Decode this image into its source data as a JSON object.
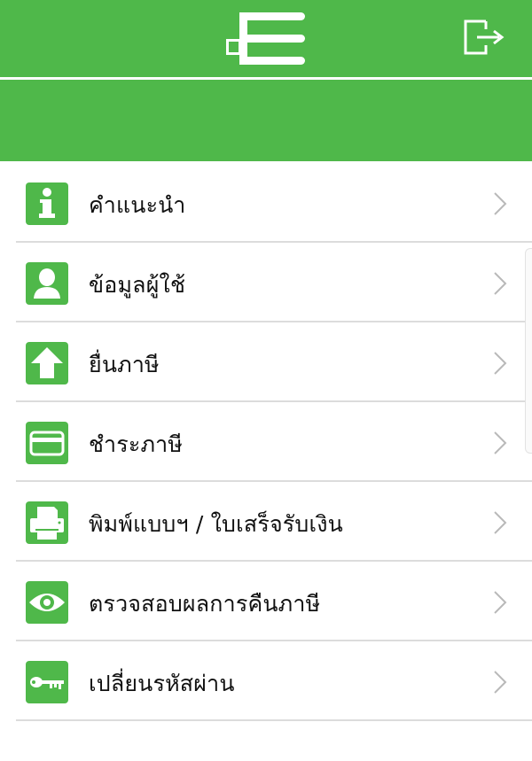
{
  "header": {
    "logo_icon": "app-logo-icon",
    "logout_icon": "logout-icon",
    "accent_color": "#4fb84a"
  },
  "menu": {
    "items": [
      {
        "label": "คำแนะนำ",
        "icon": "info-icon"
      },
      {
        "label": "ข้อมูลผู้ใช้",
        "icon": "user-icon"
      },
      {
        "label": "ยื่นภาษี",
        "icon": "upload-arrow-icon"
      },
      {
        "label": "ชำระภาษี",
        "icon": "credit-card-icon"
      },
      {
        "label": "พิมพ์แบบฯ / ใบเสร็จรับเงิน",
        "icon": "printer-icon"
      },
      {
        "label": "ตรวจสอบผลการคืนภาษี",
        "icon": "eye-icon"
      },
      {
        "label": "เปลี่ยนรหัสผ่าน",
        "icon": "key-icon"
      }
    ]
  }
}
